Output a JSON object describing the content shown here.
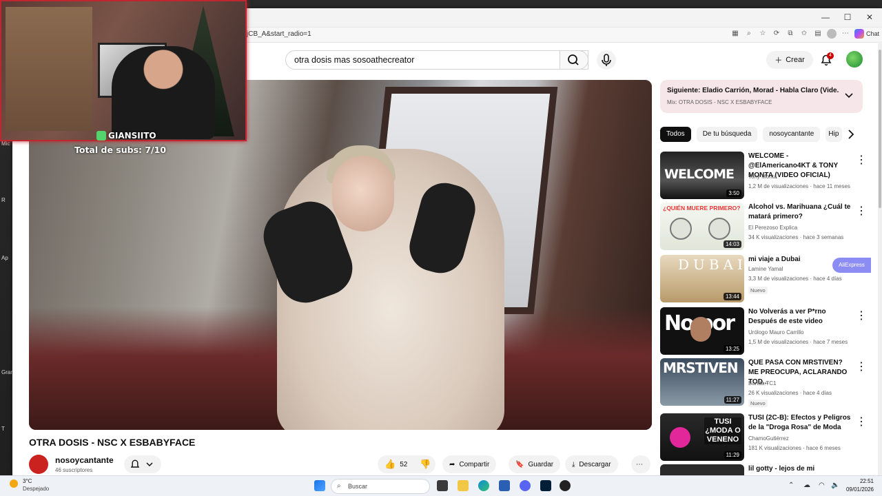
{
  "browser": {
    "url": "jCB_A&start_radio=1",
    "chat_label": "Chat"
  },
  "desktop": {
    "labels": [
      "Mic",
      "R",
      "Ap",
      "Gran",
      "T"
    ]
  },
  "youtube": {
    "search_query": "otra dosis mas sosoathecreator",
    "create_label": "Crear",
    "notification_count": "4"
  },
  "stream_overlay": {
    "streamer_name": "GIANSIITO",
    "subs_text": "Total de subs: 7/10"
  },
  "video": {
    "title": "OTRA DOSIS - NSC X ESBABYFACE",
    "channel": "nosoycantante",
    "subscribers": "46 suscriptores",
    "likes": "52",
    "share_label": "Compartir",
    "save_label": "Guardar",
    "download_label": "Descargar"
  },
  "up_next": {
    "title": "Siguiente: Eladio Carrión, Morad - Habla Claro (Vide...",
    "subtitle": "Mix: OTRA DOSIS - NSC X ESBABYFACE"
  },
  "chips": [
    "Todos",
    "De tu búsqueda",
    "nosoycantante",
    "Hip"
  ],
  "recommendations": [
    {
      "title": "WELCOME - @ElAmericano4KT & TONY MONTA (VIDEO OFICIAL)",
      "channel": "Tony Monta",
      "meta": "1,2 M de visualizaciones · hace 11 meses",
      "duration": "3:50",
      "thumb_text": "WELCOME",
      "badge": ""
    },
    {
      "title": "Alcohol vs. Marihuana ¿Cuál te matará primero?",
      "channel": "El Perezoso Explica",
      "meta": "34 K visualizaciones · hace 3 semanas",
      "duration": "14:03",
      "thumb_text": "¿QUIÉN MUERE PRIMERO?",
      "badge": ""
    },
    {
      "title": "mi viaje a Dubai",
      "channel": "Lamine Yamal",
      "meta": "3,3 M de visualizaciones · hace 4 días",
      "duration": "13:44",
      "thumb_text": "DUBAI",
      "badge": "Nuevo"
    },
    {
      "title": "No Volverás a ver P*rno Después de este video",
      "channel": "Urólogo Mauro Carrillo",
      "meta": "1,5 M de visualizaciones · hace 7 meses",
      "duration": "13:25",
      "thumb_text": "No por",
      "badge": ""
    },
    {
      "title": "QUE PASA CON MRSTIVEN? ME PREOCUPA, ACLARANDO TOD...",
      "channel": "Banda.TC1",
      "meta": "26 K visualizaciones · hace 4 días",
      "duration": "11:27",
      "thumb_text": "MRSTIVEN",
      "badge": "Nuevo"
    },
    {
      "title": "TUSI (2C-B): Efectos y Peligros de la \"Droga Rosa\" de Moda",
      "channel": "ChamoGutiérrez",
      "meta": "181 K visualizaciones · hace 6 meses",
      "duration": "11:29",
      "thumb_text": "TUSI ¿MODA O VENENO",
      "badge": ""
    },
    {
      "title": "lil gotty - lejos de mi",
      "channel": "",
      "meta": "",
      "duration": "",
      "thumb_text": "",
      "badge": ""
    }
  ],
  "aliexpress_label": "AliExpress",
  "taskbar": {
    "temperature": "3°C",
    "weather": "Despejado",
    "search_placeholder": "Buscar",
    "time": "22:51",
    "date": "09/01/2026"
  },
  "colors": {
    "yt_red": "#cc0000",
    "stream_border": "#c0262f",
    "upnext_bg": "#f6e6ea"
  }
}
